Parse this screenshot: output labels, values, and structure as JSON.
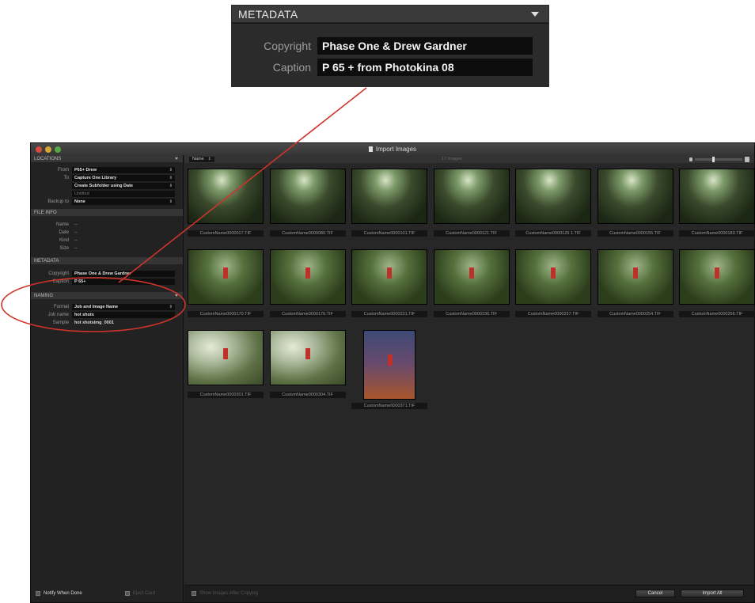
{
  "callout": {
    "title": "METADATA",
    "copyright_label": "Copyright",
    "copyright_value": "Phase One & Drew Gardner",
    "caption_label": "Caption",
    "caption_value": "P 65 + from Photokina 08"
  },
  "window": {
    "title": "Import Images"
  },
  "left_panel": {
    "locations": {
      "header": "LOCATIONS",
      "from_label": "From",
      "from_value": "P65+ Drew",
      "to_label": "To",
      "to_value": "Capture One Library",
      "subfolder_value": "Create Subfolder using Date",
      "subfolder_name": "Untitled",
      "backup_label": "Backup to",
      "backup_value": "None"
    },
    "file_info": {
      "header": "FILE INFO",
      "name_label": "Name",
      "name_value": "--",
      "date_label": "Date",
      "date_value": "--",
      "kind_label": "Kind",
      "kind_value": "--",
      "size_label": "Size",
      "size_value": "--"
    },
    "metadata": {
      "header": "METADATA",
      "copyright_label": "Copyright",
      "copyright_value": "Phase One & Drew Gardner",
      "caption_label": "Caption",
      "caption_value": "P 65+"
    },
    "naming": {
      "header": "NAMING",
      "format_label": "Format",
      "format_value": "Job and Image Name",
      "jobname_label": "Job name",
      "jobname_value": "hot shots",
      "sample_label": "Sample",
      "sample_value": "hot shotsimg_0001"
    }
  },
  "toolbar": {
    "sort_value": "Name",
    "count_text": "17 Images"
  },
  "images": [
    {
      "name": "CustomName0000017.TIF",
      "tone": "forest"
    },
    {
      "name": "CustomName0000080.TIF",
      "tone": "forest"
    },
    {
      "name": "CustomName0000101.TIF",
      "tone": "forest"
    },
    {
      "name": "CustomName0000121.TIF",
      "tone": "forest"
    },
    {
      "name": "CustomName0000129 1.TIF",
      "tone": "forest"
    },
    {
      "name": "CustomName0000155.TIF",
      "tone": "forest"
    },
    {
      "name": "CustomName0000183.TIF",
      "tone": "forest"
    },
    {
      "name": "CustomName0000170.TIF",
      "tone": "green"
    },
    {
      "name": "CustomName0000176.TIF",
      "tone": "green"
    },
    {
      "name": "CustomName0000231.TIF",
      "tone": "green"
    },
    {
      "name": "CustomName0000236.TIF",
      "tone": "green"
    },
    {
      "name": "CustomName0000237.TIF",
      "tone": "green"
    },
    {
      "name": "CustomName0000254.TIF",
      "tone": "green"
    },
    {
      "name": "CustomName0000256.TIF",
      "tone": "green"
    },
    {
      "name": "CustomName0000301.TIF",
      "tone": "misty"
    },
    {
      "name": "CustomName0000304.TIF",
      "tone": "misty"
    },
    {
      "name": "CustomName0000371.TIF",
      "tone": "portrait"
    }
  ],
  "bottom": {
    "notify_label": "Notify When Done",
    "eject_label": "Eject Card",
    "show_label": "Show Images After Copying",
    "cancel_label": "Cancel",
    "import_label": "Import All"
  },
  "colors": {
    "annotation": "#d0342c"
  }
}
